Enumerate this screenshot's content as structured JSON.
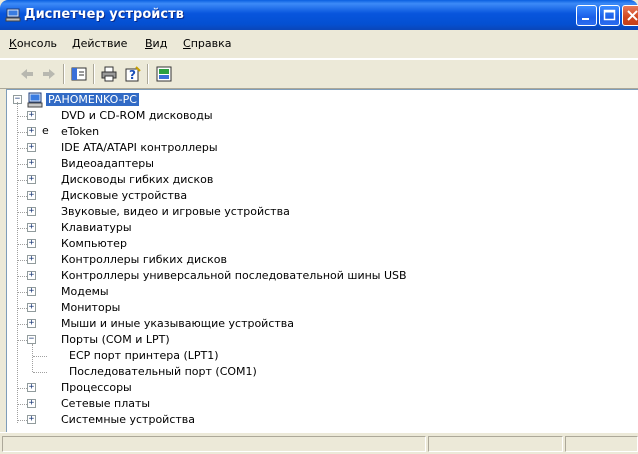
{
  "window": {
    "title": "Диспетчер устройств"
  },
  "menu": [
    {
      "label": "Консоль"
    },
    {
      "label": "Действие"
    },
    {
      "label": "Вид"
    },
    {
      "label": "Справка"
    }
  ],
  "toolbar": {
    "icons": [
      "back-arrow-icon",
      "forward-arrow-icon",
      "show-hide-tree-icon",
      "print-icon",
      "help-icon",
      "properties-icon"
    ]
  },
  "tree": {
    "root": {
      "label": "PAHOMENKO-PC",
      "icon": "computer-icon"
    },
    "items": [
      {
        "label": "DVD и CD-ROM дисководы",
        "icon": "cdrom-icon"
      },
      {
        "label": "eToken",
        "icon": "etoken-icon"
      },
      {
        "label": "IDE ATA/ATAPI контроллеры",
        "icon": "ide-controller-icon"
      },
      {
        "label": "Видеоадаптеры",
        "icon": "display-adapter-icon"
      },
      {
        "label": "Дисководы гибких дисков",
        "icon": "floppy-drive-icon"
      },
      {
        "label": "Дисковые устройства",
        "icon": "disk-drive-icon"
      },
      {
        "label": "Звуковые, видео и игровые устройства",
        "icon": "sound-device-icon"
      },
      {
        "label": "Клавиатуры",
        "icon": "keyboard-icon"
      },
      {
        "label": "Компьютер",
        "icon": "computer-icon"
      },
      {
        "label": "Контроллеры гибких дисков",
        "icon": "floppy-controller-icon"
      },
      {
        "label": "Контроллеры универсальной последовательной шины USB",
        "icon": "usb-icon"
      },
      {
        "label": "Модемы",
        "icon": "modem-icon"
      },
      {
        "label": "Мониторы",
        "icon": "monitor-icon"
      },
      {
        "label": "Мыши и иные указывающие устройства",
        "icon": "mouse-icon"
      },
      {
        "label": "Порты (COM и LPT)",
        "icon": "port-icon",
        "expanded": true,
        "children": [
          {
            "label": "ECP порт принтера (LPT1)",
            "icon": "port-icon"
          },
          {
            "label": "Последовательный порт (COM1)",
            "icon": "port-icon"
          }
        ]
      },
      {
        "label": "Процессоры",
        "icon": "processor-icon"
      },
      {
        "label": "Сетевые платы",
        "icon": "network-card-icon"
      },
      {
        "label": "Системные устройства",
        "icon": "system-device-icon"
      }
    ]
  },
  "colors": {
    "titlebar": "#0855dd",
    "selection": "#316ac5",
    "chrome": "#ece9d8"
  }
}
